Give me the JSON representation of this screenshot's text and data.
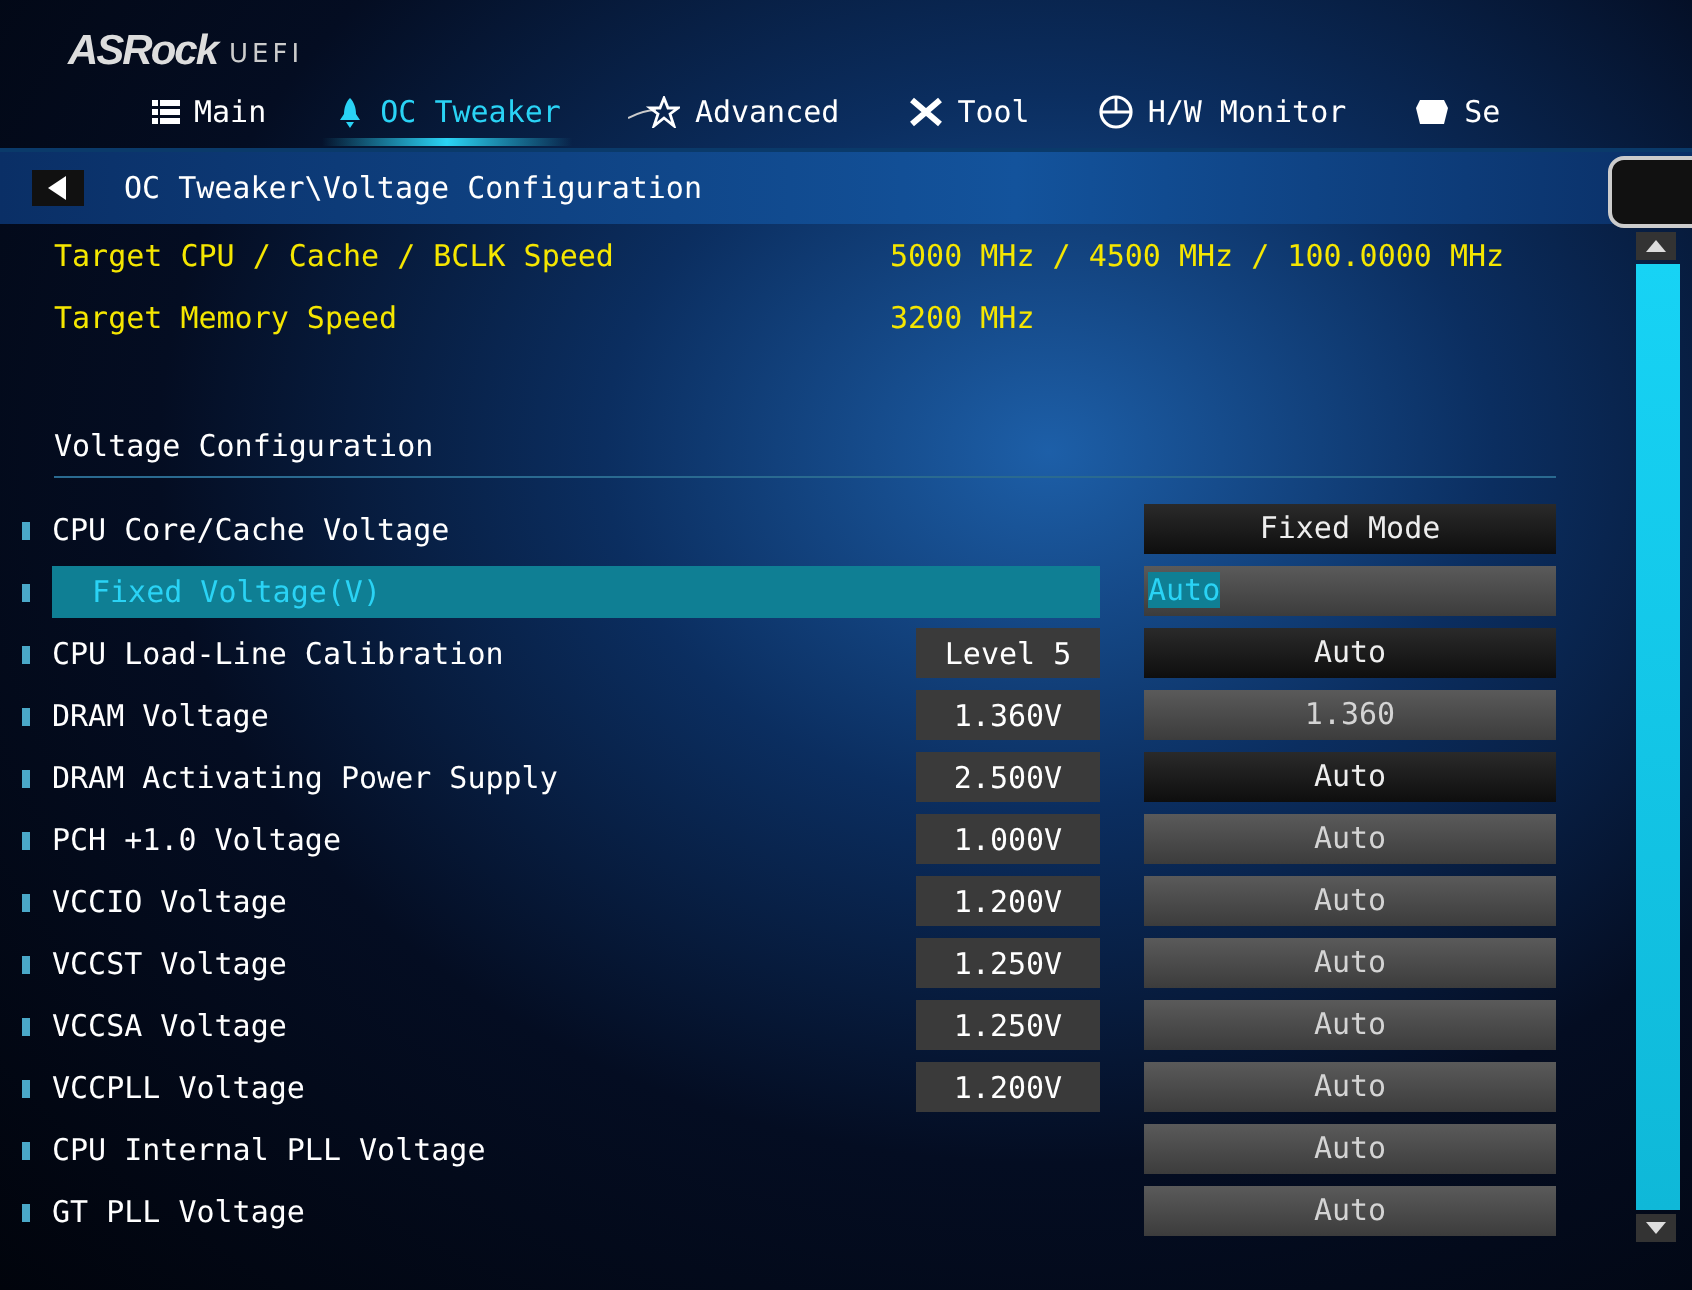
{
  "brand": {
    "logo": "ASRock",
    "suffix": "UEFI"
  },
  "tabs": [
    {
      "label": "Main",
      "selected": false
    },
    {
      "label": "OC Tweaker",
      "selected": true
    },
    {
      "label": "Advanced",
      "selected": false
    },
    {
      "label": "Tool",
      "selected": false
    },
    {
      "label": "H/W Monitor",
      "selected": false
    },
    {
      "label": "Se",
      "selected": false
    }
  ],
  "breadcrumb": "OC Tweaker\\Voltage Configuration",
  "targets": [
    {
      "label": "Target CPU / Cache / BCLK Speed",
      "value": "5000 MHz / 4500 MHz / 100.0000 MHz"
    },
    {
      "label": "Target Memory Speed",
      "value": "3200 MHz"
    }
  ],
  "section_title": "Voltage Configuration",
  "settings": [
    {
      "name": "CPU Core/Cache Voltage",
      "kind": "option",
      "value": "Fixed Mode",
      "selected": false,
      "indented": false
    },
    {
      "name": "Fixed Voltage(V)",
      "kind": "field",
      "value": "Auto",
      "selected": true,
      "indented": true
    },
    {
      "name": "CPU Load-Line Calibration",
      "reading": "Level 5",
      "kind": "option",
      "value": "Auto",
      "selected": false,
      "indented": false
    },
    {
      "name": "DRAM Voltage",
      "reading": "1.360V",
      "kind": "field",
      "value": "1.360",
      "selected": false,
      "indented": false
    },
    {
      "name": "DRAM Activating Power Supply",
      "reading": "2.500V",
      "kind": "option",
      "value": "Auto",
      "selected": false,
      "indented": false
    },
    {
      "name": "PCH +1.0 Voltage",
      "reading": "1.000V",
      "kind": "field",
      "value": "Auto",
      "selected": false,
      "indented": false
    },
    {
      "name": "VCCIO Voltage",
      "reading": "1.200V",
      "kind": "field",
      "value": "Auto",
      "selected": false,
      "indented": false
    },
    {
      "name": "VCCST Voltage",
      "reading": "1.250V",
      "kind": "field",
      "value": "Auto",
      "selected": false,
      "indented": false
    },
    {
      "name": "VCCSA Voltage",
      "reading": "1.250V",
      "kind": "field",
      "value": "Auto",
      "selected": false,
      "indented": false
    },
    {
      "name": "VCCPLL Voltage",
      "reading": "1.200V",
      "kind": "field",
      "value": "Auto",
      "selected": false,
      "indented": false
    },
    {
      "name": "CPU Internal PLL Voltage",
      "kind": "field",
      "value": "Auto",
      "selected": false,
      "indented": false
    },
    {
      "name": "GT PLL Voltage",
      "kind": "field",
      "value": "Auto",
      "selected": false,
      "indented": false
    }
  ]
}
